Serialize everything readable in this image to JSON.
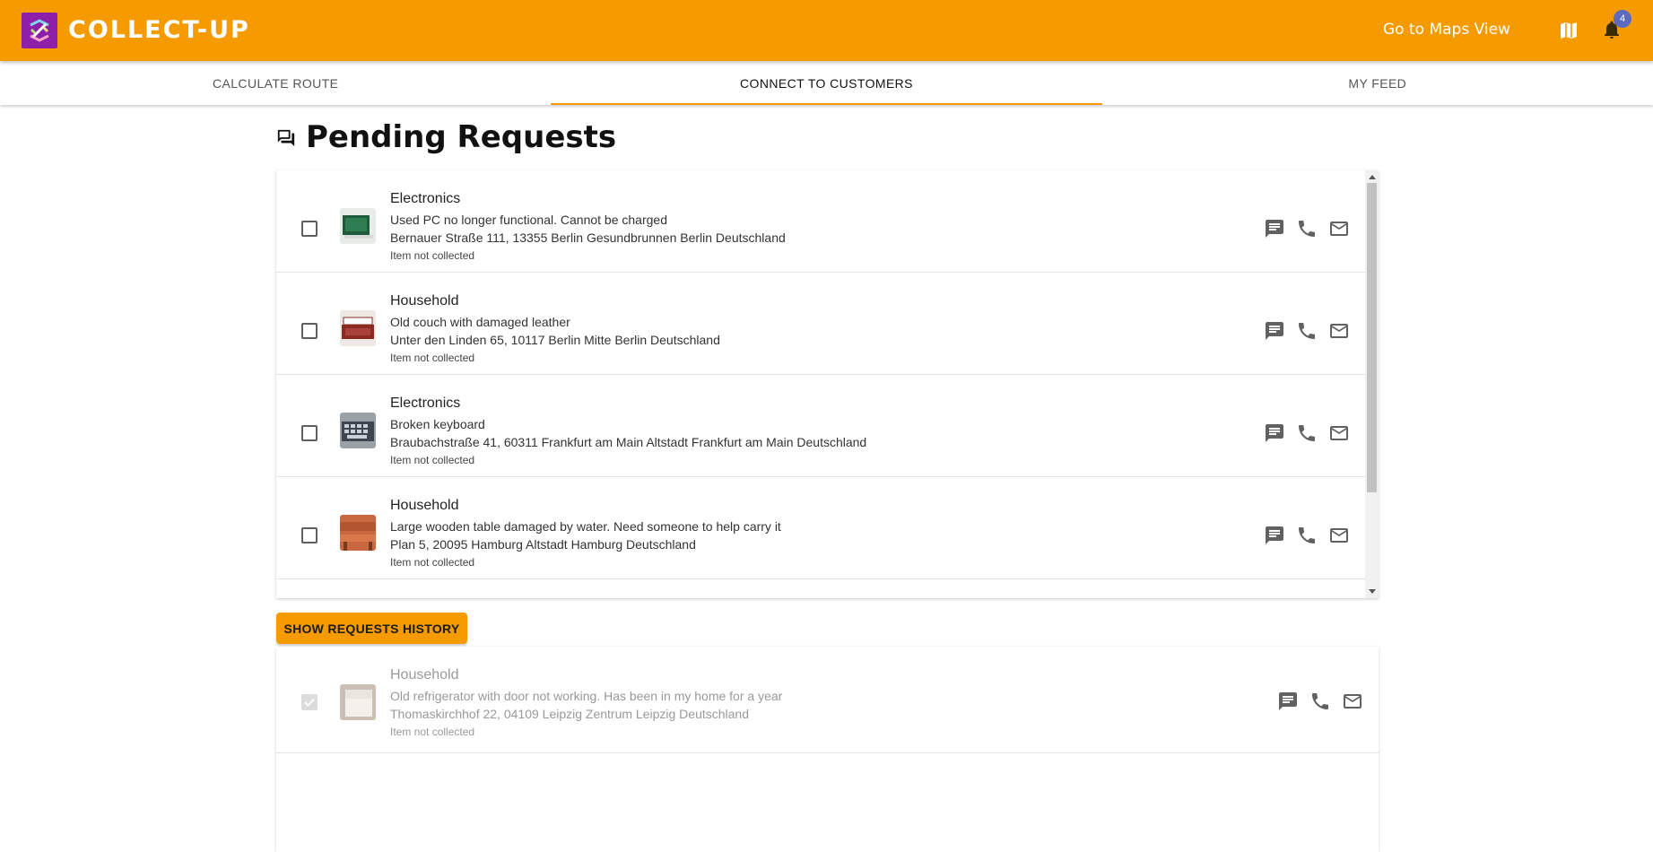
{
  "app": {
    "brand": "COLLECT-UP",
    "maps_link": "Go to Maps View",
    "notification_count": "4"
  },
  "tabs": [
    {
      "label": "CALCULATE ROUTE"
    },
    {
      "label": "CONNECT TO CUSTOMERS"
    },
    {
      "label": "MY FEED"
    }
  ],
  "page": {
    "title": "Pending Requests"
  },
  "requests": [
    {
      "category": "Electronics",
      "description": "Used PC no longer functional. Cannot be charged",
      "address": "Bernauer Straße 111, 13355 Berlin Gesundbrunnen Berlin Deutschland",
      "status": "Item not collected"
    },
    {
      "category": "Household",
      "description": "Old couch with damaged leather",
      "address": "Unter den Linden 65, 10117 Berlin Mitte Berlin Deutschland",
      "status": "Item not collected"
    },
    {
      "category": "Electronics",
      "description": "Broken keyboard",
      "address": "Braubachstraße 41, 60311 Frankfurt am Main Altstadt Frankfurt am Main Deutschland",
      "status": "Item not collected"
    },
    {
      "category": "Household",
      "description": "Large wooden table damaged by water. Need someone to help carry it",
      "address": "Plan 5, 20095 Hamburg Altstadt Hamburg Deutschland",
      "status": "Item not collected"
    }
  ],
  "history_button": {
    "label": "SHOW REQUESTS HISTORY"
  },
  "history": [
    {
      "category": "Household",
      "description": "Old refrigerator with door not working. Has been in my home for a year",
      "address": "Thomaskirchhof 22, 04109 Leipzig Zentrum Leipzig Deutschland",
      "status": "Item not collected"
    }
  ],
  "colors": {
    "primary": "#f59b00",
    "logo_bg": "#8e1fa8",
    "badge": "#5c6bc0"
  },
  "icons": {
    "title": "forum-icon",
    "chat": "chat-icon",
    "phone": "phone-icon",
    "mail": "mail-icon",
    "map": "map-icon",
    "notifications": "bell-icon"
  }
}
